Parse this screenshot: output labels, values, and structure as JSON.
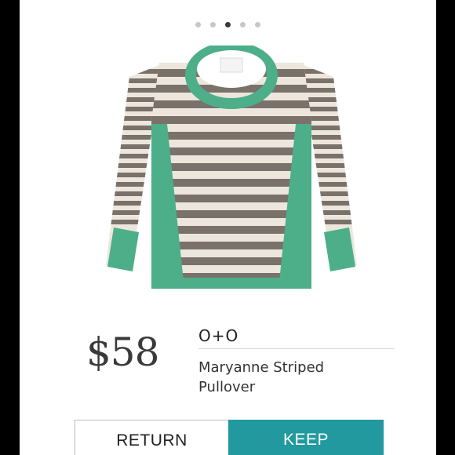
{
  "carousel": {
    "dot_count": 5,
    "active_index": 2
  },
  "product": {
    "price": "$58",
    "brand": "O+O",
    "name": "Maryanne Striped Pullover",
    "image_icon": "striped-sweater-image"
  },
  "actions": {
    "return_label": "RETURN",
    "keep_label": "KEEP"
  },
  "colors": {
    "accent_teal": "#21999e",
    "sweater_green": "#4caf8a",
    "stripe_gray": "#7a716b",
    "stripe_cream": "#ede6dc"
  }
}
